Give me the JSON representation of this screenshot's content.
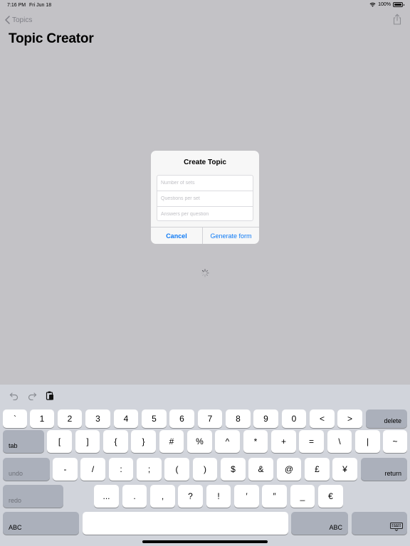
{
  "status_bar": {
    "time": "7:16 PM",
    "date": "Fri Jun 18",
    "battery_percent": "100%"
  },
  "nav": {
    "back_label": "Topics",
    "title": "Topic Creator"
  },
  "dialog": {
    "title": "Create Topic",
    "fields": [
      {
        "placeholder": "Number of sets",
        "value": ""
      },
      {
        "placeholder": "Questions per set",
        "value": ""
      },
      {
        "placeholder": "Answers per question",
        "value": ""
      }
    ],
    "cancel_label": "Cancel",
    "confirm_label": "Generate form"
  },
  "keyboard": {
    "row1": [
      "`",
      "1",
      "2",
      "3",
      "4",
      "5",
      "6",
      "7",
      "8",
      "9",
      "0",
      "<",
      ">"
    ],
    "delete_label": "delete",
    "tab_label": "tab",
    "row2": [
      "[",
      "]",
      "{",
      "}",
      "#",
      "%",
      "^",
      "*",
      "+",
      "=",
      "\\",
      "|",
      "~"
    ],
    "undo_label": "undo",
    "row3": [
      "-",
      "/",
      ":",
      ";",
      "(",
      ")",
      "$",
      "&",
      "@",
      "£",
      "¥"
    ],
    "return_label": "return",
    "redo_label": "redo",
    "row4": [
      "...",
      ".",
      ",",
      "?",
      "!",
      "′",
      "″",
      "_",
      "€"
    ],
    "abc_label": "ABC",
    "colors": {
      "key": "#ffffff",
      "function_key": "#abb0bb",
      "keyboard_bg": "#d1d4db",
      "accent": "#0e7af5"
    }
  }
}
